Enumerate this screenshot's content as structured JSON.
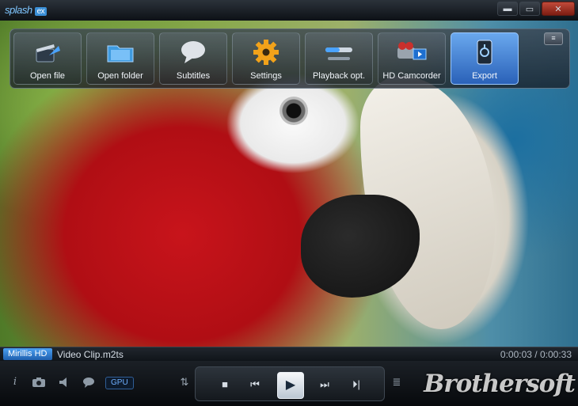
{
  "app": {
    "logo_text": "splash",
    "logo_badge": "ex"
  },
  "window_controls": {
    "minimize": "▬",
    "maximize": "▭",
    "close": "✕"
  },
  "toolbar": {
    "buttons": [
      {
        "label": "Open file",
        "icon": "open-file-clapper-icon"
      },
      {
        "label": "Open folder",
        "icon": "folder-icon"
      },
      {
        "label": "Subtitles",
        "icon": "speech-bubble-icon"
      },
      {
        "label": "Settings",
        "icon": "gear-icon"
      },
      {
        "label": "Playback opt.",
        "icon": "slider-icon"
      },
      {
        "label": "HD Camcorder",
        "icon": "camcorder-icon"
      },
      {
        "label": "Export",
        "icon": "export-device-icon",
        "active": true
      }
    ],
    "collapse_glyph": "≡"
  },
  "status": {
    "badge": "Mirillis HD",
    "filename": "Video Clip.m2ts",
    "timecode": "0:00:03 / 0:00:33"
  },
  "controls": {
    "info": "i",
    "gpu_label": "GPU",
    "stop": "■",
    "prev": "⏮",
    "play": "▶",
    "next": "⏭",
    "frame_step": "⏵|",
    "playlist": "≣",
    "equalizer": "⇅"
  },
  "watermark": "Brothersoft",
  "colors": {
    "accent": "#2a61b8",
    "badge": "#1e5fae",
    "close": "#c24a3a"
  }
}
